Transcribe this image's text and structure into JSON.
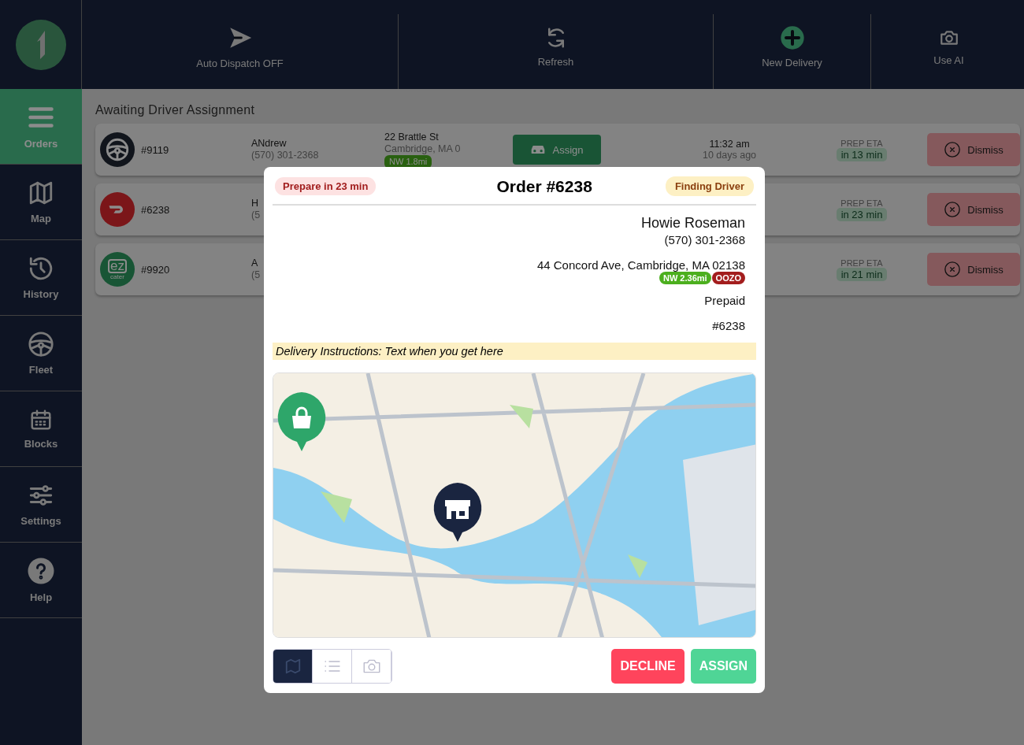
{
  "toolbar": [
    {
      "kind": "plane",
      "label": "Auto Dispatch OFF"
    },
    {
      "kind": "refresh",
      "label": "Refresh"
    },
    {
      "kind": "plus",
      "label": "New Delivery"
    },
    {
      "kind": "camera",
      "label": "Use AI"
    }
  ],
  "sidebar": {
    "items": [
      {
        "kind": "orders",
        "label": "Orders",
        "selected": true
      },
      {
        "kind": "map",
        "label": "Map",
        "selected": false
      },
      {
        "kind": "history",
        "label": "History",
        "selected": false
      },
      {
        "kind": "fleet",
        "label": "Fleet",
        "selected": false
      },
      {
        "kind": "blocks",
        "label": "Blocks",
        "selected": false
      },
      {
        "kind": "settings",
        "label": "Settings",
        "selected": false
      },
      {
        "kind": "help",
        "label": "Help",
        "selected": false
      }
    ]
  },
  "orders": {
    "heading": "Awaiting Driver Assignment",
    "rows": [
      {
        "logo": {
          "kind": "wheel"
        },
        "number": "#9119",
        "customer_name": "ANdrew",
        "customer_phone": "(570) 301-2368",
        "street": "22 Brattle St",
        "city": "Cambridge, MA 0",
        "distance": "NW 1.8mi",
        "assign": "Assign",
        "time": "11:32 am",
        "time_ago": "10 days ago",
        "eta_label": "PREP ETA",
        "eta": "in 13 min",
        "dismiss": "Dismiss"
      },
      {
        "logo": {
          "kind": "doordash"
        },
        "number": "#6238",
        "customer_name": "H",
        "customer_phone": "(5",
        "eta_label": "PREP ETA",
        "eta": "in 23 min",
        "dismiss": "Dismiss"
      },
      {
        "logo": {
          "kind": "ezcater",
          "text": "ez",
          "subtext": "cater"
        },
        "number": "#9920",
        "customer_name": "A",
        "customer_phone": "(5",
        "eta_label": "PREP ETA",
        "eta": "in 21 min",
        "dismiss": "Dismiss"
      }
    ]
  },
  "modal": {
    "prep_badge": "Prepare in 23 min",
    "title": "Order #6238",
    "status_badge": "Finding Driver",
    "customer_name": "Howie Roseman",
    "phone": "(570) 301-2368",
    "address": "44 Concord Ave, Cambridge, MA 02138",
    "tags": [
      {
        "label": "NW 2.36mi",
        "color": "#4caf1e"
      },
      {
        "label": "OOZO",
        "color": "#a31d1d"
      }
    ],
    "payment": "Prepaid",
    "order_ref": "#6238",
    "instructions": "Delivery Instructions: Text when you get here",
    "view_tabs": [
      {
        "kind": "map",
        "selected": true
      },
      {
        "kind": "list",
        "selected": false
      },
      {
        "kind": "camera",
        "selected": false
      }
    ],
    "decline": "DECLINE",
    "assign": "ASSIGN"
  }
}
